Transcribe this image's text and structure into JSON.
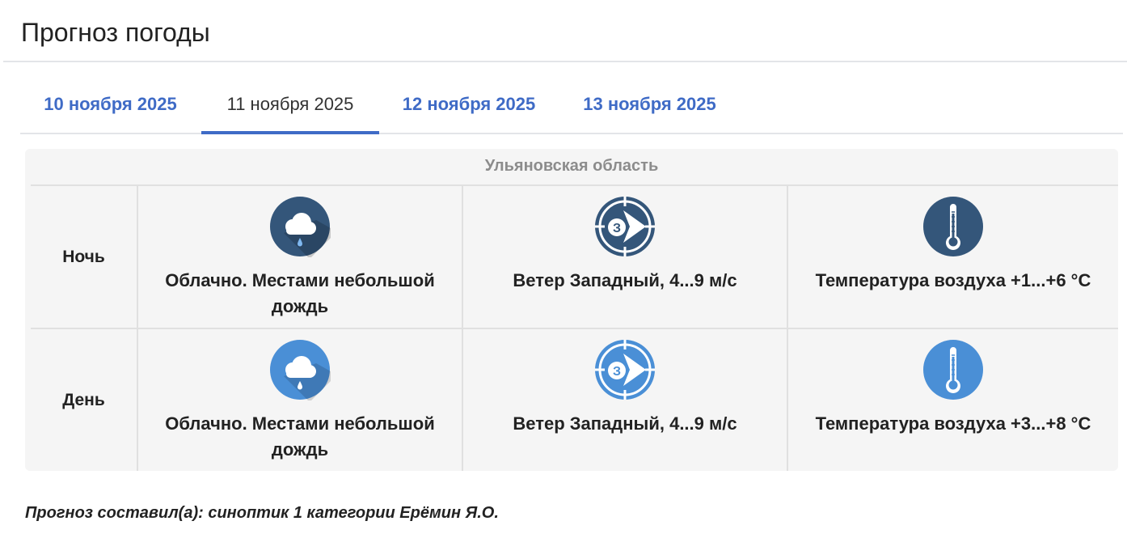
{
  "page": {
    "title": "Прогноз погоды"
  },
  "tabs": [
    {
      "label": "10 ноября 2025",
      "active": false
    },
    {
      "label": "11 ноября 2025",
      "active": true
    },
    {
      "label": "12 ноября 2025",
      "active": false
    },
    {
      "label": "13 ноября 2025",
      "active": false
    }
  ],
  "forecast": {
    "region": "Ульяновская область",
    "rows": [
      {
        "period": "Ночь",
        "icon_color": "#34567a",
        "sky": {
          "icon": "cloud-rain-icon",
          "text": "Облачно. Местами небольшой дождь"
        },
        "wind": {
          "icon": "wind-west-icon",
          "direction_letter": "З",
          "text": "Ветер Западный, 4...9 м/с"
        },
        "temperature": {
          "icon": "thermometer-icon",
          "text": "Температура воздуха +1...+6 °C"
        }
      },
      {
        "period": "День",
        "icon_color": "#4a8fd6",
        "sky": {
          "icon": "cloud-rain-icon",
          "text": "Облачно. Местами небольшой дождь"
        },
        "wind": {
          "icon": "wind-west-icon",
          "direction_letter": "З",
          "text": "Ветер Западный, 4...9 м/с"
        },
        "temperature": {
          "icon": "thermometer-icon",
          "text": "Температура воздуха +3...+8 °C"
        }
      }
    ]
  },
  "author": "Прогноз составил(а): синоптик 1 категории Ерёмин Я.О."
}
